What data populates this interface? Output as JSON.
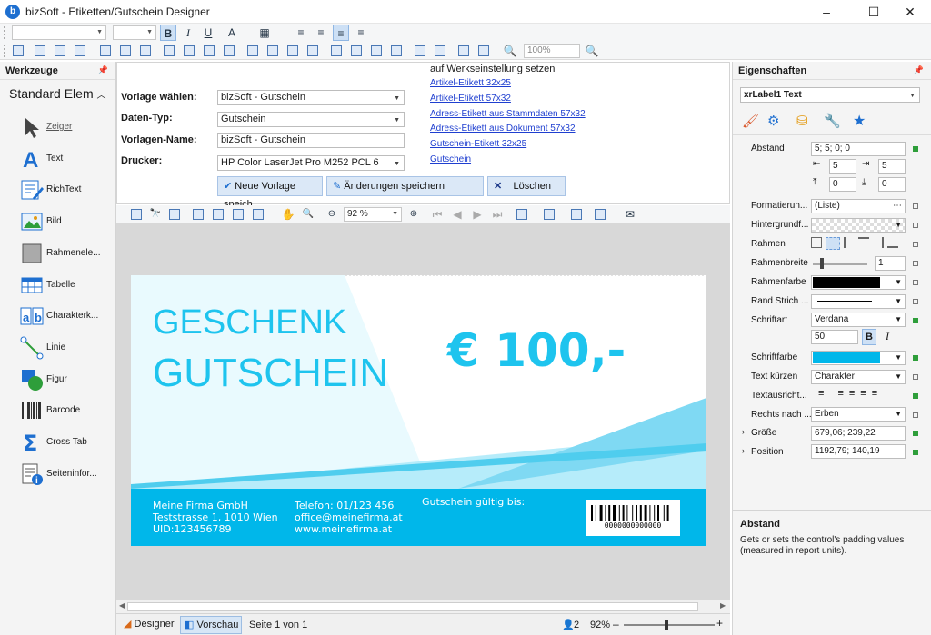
{
  "window": {
    "title": "bizSoft - Etiketten/Gutschein Designer",
    "app_icon_letter": "b",
    "minimize_glyph": "–",
    "maximize_glyph": "☐",
    "close_glyph": "✕"
  },
  "toolbar": {
    "bold": "B",
    "italic": "I",
    "underline": "U",
    "zoom_value": "100%"
  },
  "left_panel": {
    "title": "Werkzeuge",
    "group": "Standard Elem",
    "tools": [
      {
        "label": "Zeiger",
        "icon": "pointer-icon"
      },
      {
        "label": "Text",
        "icon": "text-icon"
      },
      {
        "label": "RichText",
        "icon": "richtext-icon"
      },
      {
        "label": "Bild",
        "icon": "image-icon"
      },
      {
        "label": "Rahmenele...",
        "icon": "frame-icon"
      },
      {
        "label": "Tabelle",
        "icon": "table-icon"
      },
      {
        "label": "Charakterk...",
        "icon": "character-comb-icon"
      },
      {
        "label": "Linie",
        "icon": "line-icon"
      },
      {
        "label": "Figur",
        "icon": "shape-icon"
      },
      {
        "label": "Barcode",
        "icon": "barcode-icon"
      },
      {
        "label": "Cross Tab",
        "icon": "sigma-icon"
      },
      {
        "label": "Seiteninfor...",
        "icon": "page-info-icon"
      }
    ]
  },
  "form": {
    "vorlage_label": "Vorlage wählen:",
    "vorlage_value": "bizSoft - Gutschein",
    "datentyp_label": "Daten-Typ:",
    "datentyp_value": "Gutschein",
    "vorlagenname_label": "Vorlagen-Name:",
    "vorlagenname_value": "bizSoft - Gutschein",
    "drucker_label": "Drucker:",
    "drucker_value": "HP Color LaserJet Pro M252 PCL 6",
    "btn_new": "Neue Vorlage speich",
    "btn_save": "Änderungen speichern",
    "btn_delete": "Löschen",
    "reset_heading": "auf  Werkseinstellung setzen",
    "links": [
      "Artikel-Etikett 32x25",
      "Artikel-Etikett 57x32",
      "Adress-Etikett aus Stammdaten 57x32",
      "Adress-Etikett aus Dokument 57x32",
      "Gutschein-Etikett 32x25",
      "Gutschein"
    ]
  },
  "preview_toolbar": {
    "zoom": "92 %"
  },
  "voucher": {
    "line1": "GESCHENK",
    "line2": "GUTSCHEIN",
    "amount": "€ 100,-",
    "company": "Meine Firma GmbH",
    "street": "Teststrasse 1, 1010 Wien",
    "uid": "UID:123456789",
    "phone": "Telefon: 01/123 456",
    "email": "office@meinefirma.at",
    "web": "www.meinefirma.at",
    "valid": "Gutschein gültig bis:",
    "barcode_text": "0000000000000"
  },
  "statusbar": {
    "tab_designer": "Designer",
    "tab_preview": "Vorschau",
    "page": "Seite 1 von 1",
    "users": "2",
    "zoom": "92%"
  },
  "properties": {
    "title": "Eigenschaften",
    "selected": "xrLabel1   Text",
    "abstand_label": "Abstand",
    "abstand_value": "5; 5; 0; 0",
    "pad_left": "5",
    "pad_right": "5",
    "pad_top": "0",
    "pad_bottom": "0",
    "formatierung_label": "Formatierun...",
    "formatierung_value": "(Liste)",
    "hintergrund_label": "Hintergrundf...",
    "rahmen_label": "Rahmen",
    "rahmenbreite_label": "Rahmenbreite",
    "rahmenbreite_value": "1",
    "rahmenfarbe_label": "Rahmenfarbe",
    "randstrich_label": "Rand Strich ...",
    "schriftart_label": "Schriftart",
    "schriftart_value": "Verdana",
    "schriftgroesse_value": "50",
    "schriftfarbe_label": "Schriftfarbe",
    "textkuerzen_label": "Text kürzen",
    "textkuerzen_value": "Charakter",
    "textausricht_label": "Textausricht...",
    "rechtsnach_label": "Rechts nach ...",
    "rechtsnach_value": "Erben",
    "groesse_label": "Größe",
    "groesse_value": "679,06; 239,22",
    "position_label": "Position",
    "position_value": "1192,79; 140,19",
    "desc_title": "Abstand",
    "desc_text": "Gets or sets the control's padding values (measured in report units)."
  },
  "colors": {
    "accent": "#00b7ea",
    "voucher_text": "#1ec4ee",
    "link": "#1f3fd0"
  }
}
